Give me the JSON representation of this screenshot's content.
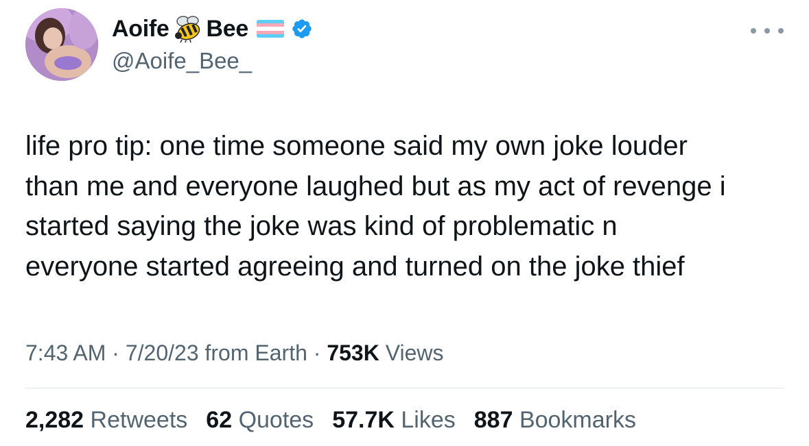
{
  "author": {
    "display_name_first": "Aoife",
    "display_name_last": "Bee",
    "handle": "@Aoife_Bee_",
    "avatar": "avatar-photo",
    "emoji_icon": "bee-icon",
    "flag_icon": "transgender-flag-icon",
    "verified_icon": "verified-badge-icon",
    "verified_color": "#1d9bf0"
  },
  "more_icon": "more-options-icon",
  "tweet": {
    "lines": [
      "life pro tip: one time someone said my own joke louder",
      "than me and everyone laughed but as my act of revenge i",
      "started saying the joke was kind of problematic n",
      "everyone started agreeing and turned on the joke thief"
    ]
  },
  "meta": {
    "time": "7:43 AM",
    "separator": " · ",
    "date": "7/20/23",
    "source": "from Earth",
    "views_count": "753K",
    "views_label": "Views"
  },
  "stats": [
    {
      "count": "2,282",
      "label": "Retweets"
    },
    {
      "count": "62",
      "label": "Quotes"
    },
    {
      "count": "57.7K",
      "label": "Likes"
    },
    {
      "count": "887",
      "label": "Bookmarks"
    }
  ],
  "colors": {
    "text_primary": "#0f1419",
    "text_secondary": "#536471",
    "flag_blue": "#5bcefa",
    "flag_pink": "#f5a9b8",
    "flag_white": "#ffffff"
  }
}
